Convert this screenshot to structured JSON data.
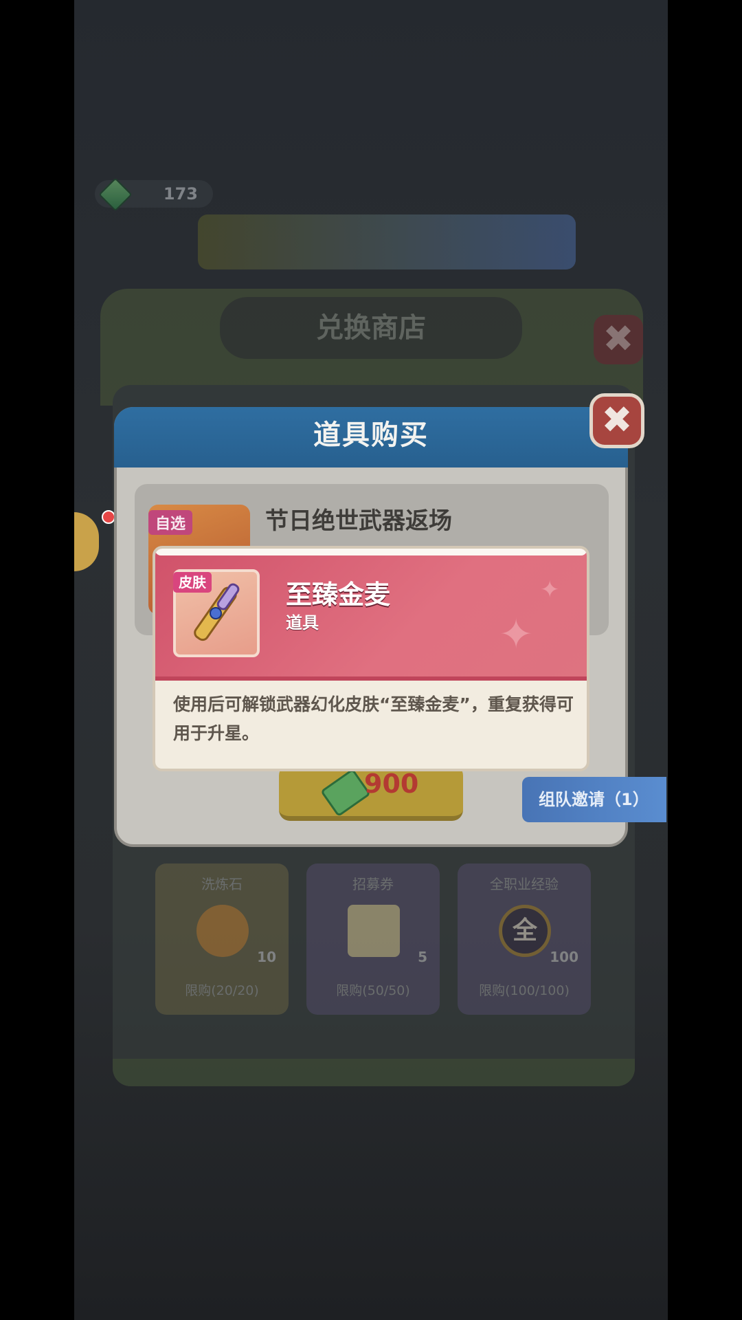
{
  "gems": {
    "count": "173"
  },
  "shop": {
    "title": "兑换商店"
  },
  "cards": [
    {
      "name": "洗炼石",
      "qty": "10",
      "limit": "限购(20/20)"
    },
    {
      "name": "招募券",
      "qty": "5",
      "limit": "限购(50/50)"
    },
    {
      "name": "全职业经验",
      "qty": "100",
      "limit": "限购(100/100)",
      "icon_text": "全"
    }
  ],
  "popup": {
    "title": "道具购买",
    "close_glyph": "✖",
    "tag": "自选",
    "item_name": "节日绝世武器返场",
    "price": "900"
  },
  "tooltip": {
    "tag": "皮肤",
    "name": "至臻金麦",
    "type": "道具",
    "description": "使用后可解锁武器幻化皮肤“至臻金麦”，重复获得可用于升星。"
  },
  "team_invite": {
    "label": "组队邀请（1）"
  },
  "icons": [
    "gem-icon",
    "close-icon",
    "ticket-icon",
    "weapon-skin-icon",
    "gift-icon",
    "stone-icon",
    "scroll-icon",
    "exp-coin-icon"
  ],
  "colors": {
    "popup_header": "#2f6ea1",
    "tooltip_header": "#d0526a",
    "price": "#b33a32",
    "buy_button": "#b59a38"
  }
}
